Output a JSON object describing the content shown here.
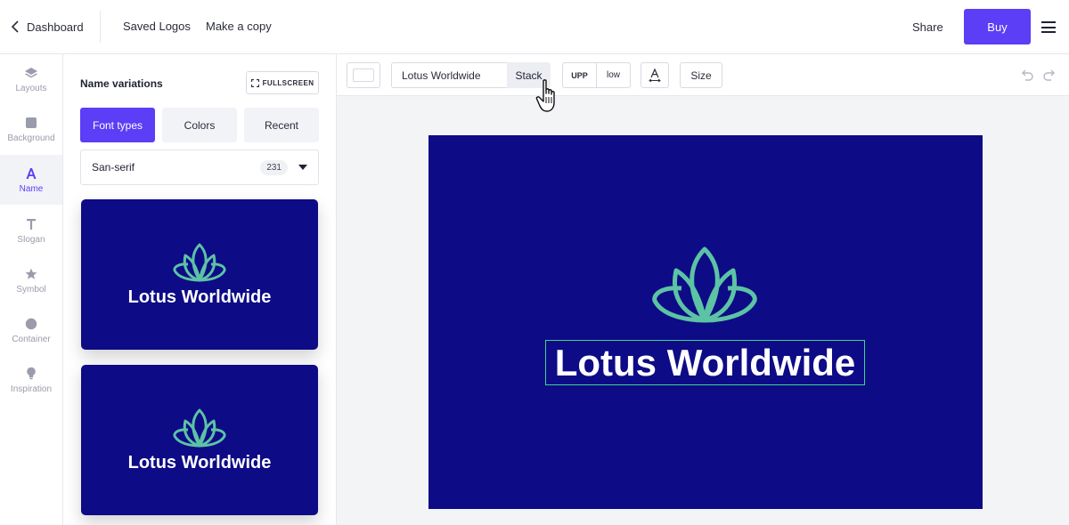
{
  "header": {
    "back_label": "Dashboard",
    "saved_logos": "Saved Logos",
    "make_copy": "Make a copy",
    "share": "Share",
    "buy": "Buy"
  },
  "rail": {
    "items": [
      {
        "label": "Layouts",
        "icon": "layers-icon"
      },
      {
        "label": "Background",
        "icon": "square-icon"
      },
      {
        "label": "Name",
        "icon": "letter-a-icon",
        "active": true
      },
      {
        "label": "Slogan",
        "icon": "letter-t-icon"
      },
      {
        "label": "Symbol",
        "icon": "star-icon"
      },
      {
        "label": "Container",
        "icon": "circle-icon"
      },
      {
        "label": "Inspiration",
        "icon": "lightbulb-icon"
      }
    ]
  },
  "panel": {
    "title": "Name variations",
    "fullscreen": "FULLSCREEN",
    "tabs": [
      {
        "label": "Font types",
        "active": true
      },
      {
        "label": "Colors"
      },
      {
        "label": "Recent"
      }
    ],
    "font_select": {
      "value": "San-serif",
      "count": "231"
    },
    "cards": [
      {
        "name": "Lotus Worldwide"
      },
      {
        "name": "Lotus Worldwide"
      }
    ]
  },
  "toolbar": {
    "text_value": "Lotus Worldwide",
    "stack": "Stack",
    "upper": "UPP",
    "lower": "low",
    "size": "Size"
  },
  "canvas": {
    "logo_name": "Lotus Worldwide"
  },
  "colors": {
    "accent": "#5b3ef5",
    "logo_background": "#0d0b86",
    "symbol_color": "#5cc3a4",
    "selection_outline": "#3fd38d"
  }
}
